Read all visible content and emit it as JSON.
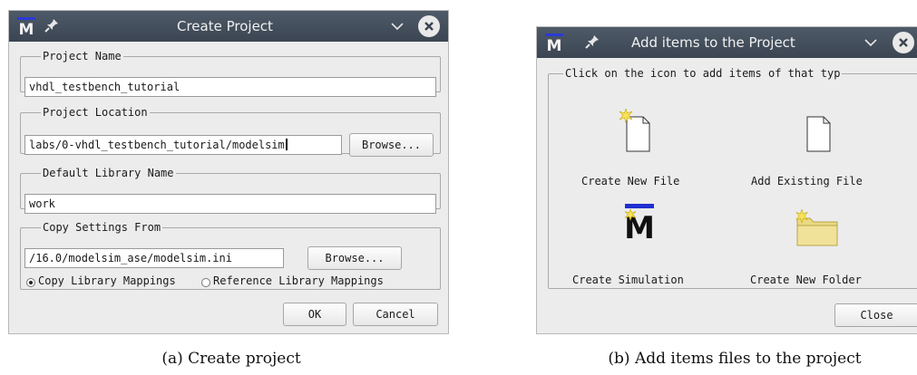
{
  "create_project": {
    "title": "Create Project",
    "project_name": {
      "legend": "Project Name",
      "value": "vhdl_testbench_tutorial"
    },
    "project_location": {
      "legend": "Project Location",
      "value": "labs/0-vhdl_testbench_tutorial/modelsim",
      "browse": "Browse..."
    },
    "default_library": {
      "legend": "Default Library Name",
      "value": "work"
    },
    "copy_settings": {
      "legend": "Copy Settings From",
      "value": "/16.0/modelsim_ase/modelsim.ini",
      "browse": "Browse...",
      "option_copy": "Copy Library Mappings",
      "option_reference": "Reference Library Mappings",
      "selected": "copy"
    },
    "ok": "OK",
    "cancel": "Cancel",
    "caption": "(a) Create project"
  },
  "add_items": {
    "title": "Add items to the Project",
    "legend": "Click on the icon to add items of that typ",
    "items": [
      {
        "label": "Create New File",
        "icon": "new-file-icon"
      },
      {
        "label": "Add Existing File",
        "icon": "file-icon"
      },
      {
        "label": "Create Simulation",
        "icon": "modelsim-logo-icon"
      },
      {
        "label": "Create New Folder",
        "icon": "new-folder-icon"
      }
    ],
    "close": "Close",
    "caption": "(b) Add items files to the project"
  },
  "colors": {
    "titlebar": "#434d5a",
    "dialog_bg": "#ececec",
    "logo_blue": "#1f2fd0",
    "folder": "#e2d27e"
  }
}
